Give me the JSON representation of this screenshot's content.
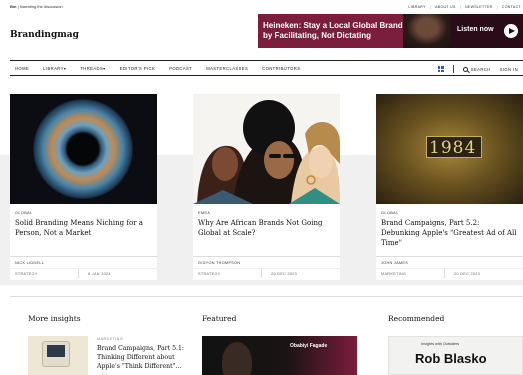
{
  "topbar": {
    "brand_short": "Bm",
    "tagline": "| Narrating the discussion",
    "links": [
      "LIBRARY",
      "ABOUT US",
      "NEWSLETTER",
      "CONTACT"
    ]
  },
  "logo": "Brandingmag",
  "ad": {
    "headline": "Heineken: Stay a Local Global Brand by Facilitating, Not Dictating",
    "cta": "Listen now"
  },
  "nav": {
    "items": [
      "HOME",
      "LIBRARY",
      "THREADS",
      "EDITOR'S PICK",
      "PODCAST",
      "MASTERCLASSES",
      "CONTRIBUTORS"
    ],
    "search": "SEARCH",
    "signin": "SIGN IN"
  },
  "cards": [
    {
      "region": "GLOBAL",
      "title": "Solid Branding Means Niching for a Person, Not a Market",
      "author": "NICK LIDDELL",
      "category": "STRATEGY",
      "date": "8 JAN 2024"
    },
    {
      "region": "EMEA",
      "title": "Why Are African Brands Not Going Global at Scale?",
      "author": "GIDYON THOMPSON",
      "category": "STRATEGY",
      "date": "29 DEC 2023"
    },
    {
      "region": "GLOBAL",
      "title": "Brand Campaigns, Part 5.2: Debunking Apple's \"Greatest Ad of All Time\"",
      "author": "JOHN JAMES",
      "category": "MARKETING",
      "date": "20 DEC 2023"
    }
  ],
  "card_image_text": "1984",
  "sections": {
    "insights": "More insights",
    "featured": "Featured",
    "recommended": "Recommended"
  },
  "insight": {
    "category": "MARKETING",
    "title": "Brand Campaigns, Part 5.1: Thinking Different about Apple's \"Think Different\"..."
  },
  "featured": {
    "name": "Obabiyi Fagade"
  },
  "recommended": {
    "small": "Insights with Outsiders",
    "big": "Rob Blasko"
  }
}
